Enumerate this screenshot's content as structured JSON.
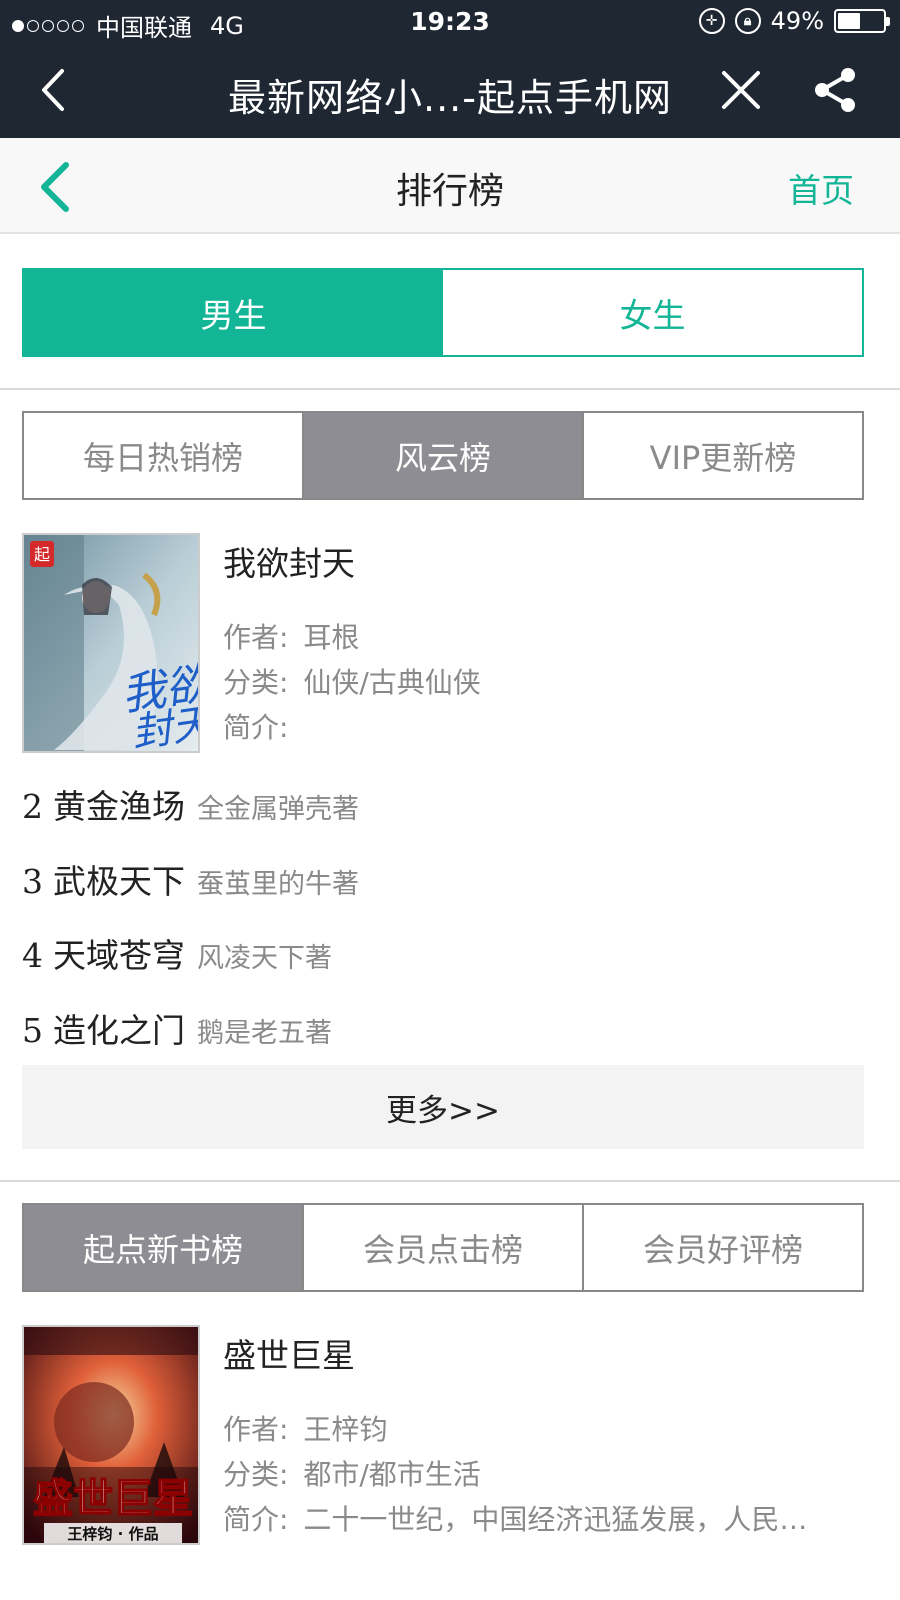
{
  "status_bar": {
    "carrier": "中国联通",
    "network": "4G",
    "time": "19:23",
    "battery": "49%",
    "battery_level": 0.49,
    "signal_bars": 1,
    "signal_total": 5
  },
  "nav_bar": {
    "title": "最新网络小...-起点手机网",
    "icons": [
      "back-arrow-icon",
      "close-icon",
      "share-icon"
    ]
  },
  "page_header": {
    "title": "排行榜",
    "home_link": "首页"
  },
  "gender_tabs": [
    {
      "label": "男生",
      "active": true
    },
    {
      "label": "女生",
      "active": false
    }
  ],
  "section1": {
    "tabs": [
      {
        "label": "每日热销榜",
        "active": false
      },
      {
        "label": "风云榜",
        "active": true
      },
      {
        "label": "VIP更新榜",
        "active": false
      }
    ],
    "featured": {
      "title": "我欲封天",
      "author_label": "作者:",
      "author": "耳根",
      "category_label": "分类:",
      "category": "仙侠/古典仙侠",
      "intro_label": "简介:",
      "intro": ""
    },
    "list": [
      {
        "rank": "2",
        "name": "黄金渔场",
        "author": "全金属弹壳著"
      },
      {
        "rank": "3",
        "name": "武极天下",
        "author": "蚕茧里的牛著"
      },
      {
        "rank": "4",
        "name": "天域苍穹",
        "author": "风凌天下著"
      },
      {
        "rank": "5",
        "name": "造化之门",
        "author": "鹅是老五著"
      }
    ],
    "more": "更多>>"
  },
  "section2": {
    "tabs": [
      {
        "label": "起点新书榜",
        "active": true
      },
      {
        "label": "会员点击榜",
        "active": false
      },
      {
        "label": "会员好评榜",
        "active": false
      }
    ],
    "featured": {
      "title": "盛世巨星",
      "author_label": "作者:",
      "author": "王梓钧",
      "category_label": "分类:",
      "category": "都市/都市生活",
      "intro_label": "简介:",
      "intro": "二十一世纪，中国经济迅猛发展，人民…"
    }
  },
  "colors": {
    "accent": "#12b595",
    "nav_bg": "#1f2733",
    "tab_active_gray": "#8d8d93"
  }
}
